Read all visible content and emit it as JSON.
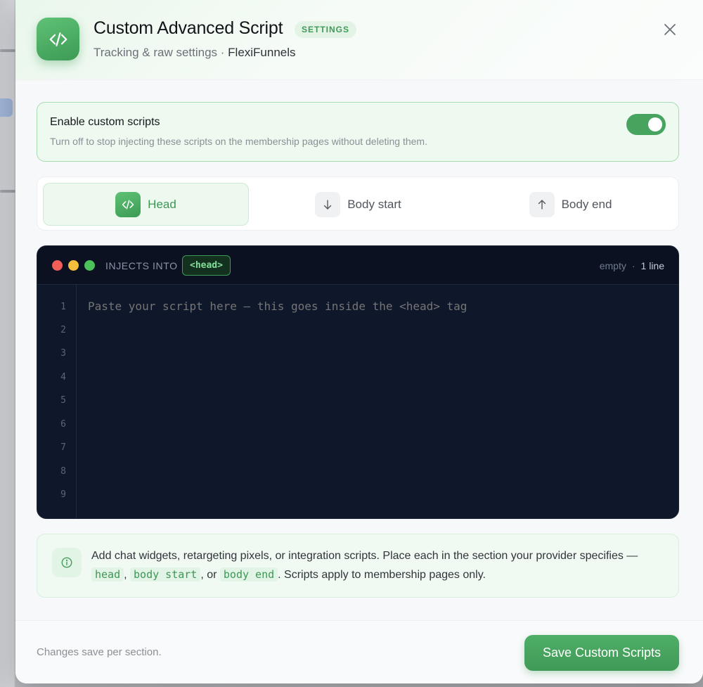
{
  "header": {
    "title": "Custom Advanced Script",
    "badge": "SETTINGS",
    "subtitle_prefix": "Tracking & raw settings · ",
    "subtitle_brand": "FlexiFunnels",
    "app_icon": "code-icon",
    "close_icon": "close-icon"
  },
  "toggle": {
    "title": "Enable custom scripts",
    "description": "Turn off to stop injecting these scripts on the membership pages without deleting them.",
    "enabled": true,
    "color": "#46a45f"
  },
  "tabs": [
    {
      "label": "Head",
      "icon": "code-icon",
      "active": true
    },
    {
      "label": "Body start",
      "icon": "arrow-down-icon",
      "active": false
    },
    {
      "label": "Body end",
      "icon": "arrow-up-icon",
      "active": false
    }
  ],
  "editor": {
    "inject_label": "INJECTS INTO",
    "tag": "<head>",
    "status": "empty",
    "separator": "·",
    "line_count": "1 line",
    "placeholder": "Paste your script here — this goes inside the <head> tag",
    "line_numbers": [
      "1",
      "2",
      "3",
      "4",
      "5",
      "6",
      "7",
      "8",
      "9"
    ],
    "window_dots": [
      "#ef5f57",
      "#f4bd3b",
      "#4cc15a"
    ]
  },
  "info": {
    "icon": "info-icon",
    "text_1": "Add chat widgets, retargeting pixels, or integration scripts. Place each in the section your provider specifies — ",
    "code_head": "head",
    "sep_1": ", ",
    "code_body_start": "body start",
    "sep_2": ", or ",
    "code_body_end": "body end",
    "text_2": ". Scripts apply to membership pages only."
  },
  "footer": {
    "note": "Changes save per section.",
    "save_label": "Save Custom Scripts"
  },
  "colors": {
    "accent": "#3f9a57",
    "editor_bg": "#0f172a"
  }
}
